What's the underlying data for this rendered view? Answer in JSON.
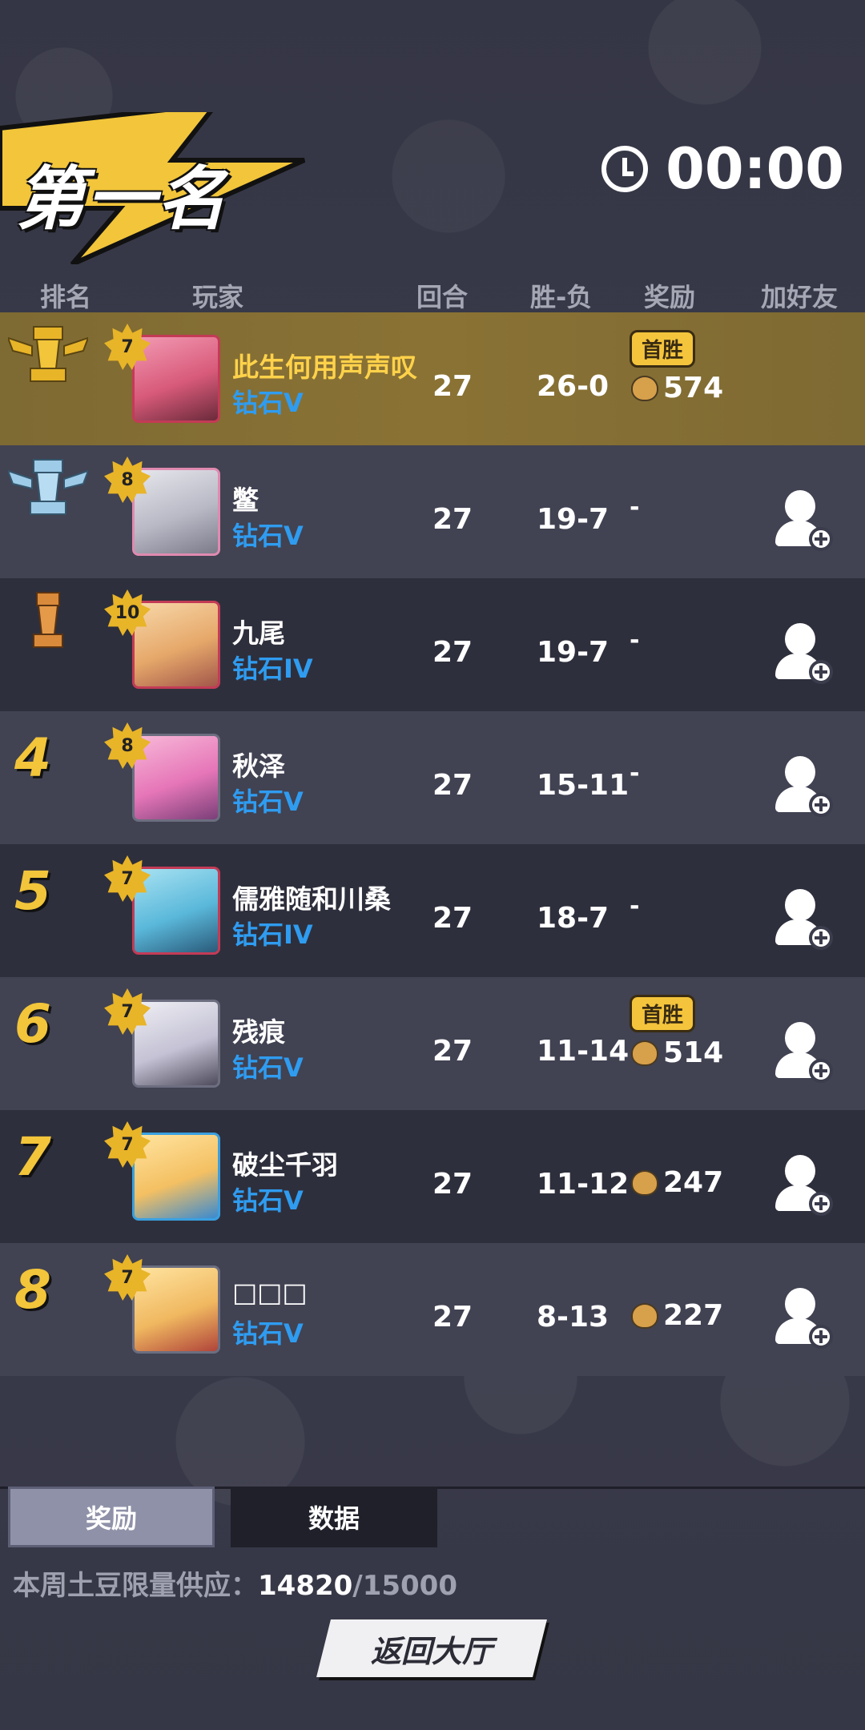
{
  "header": {
    "title": "第一名",
    "timer": "00:00"
  },
  "columns": {
    "rank": "排名",
    "player": "玩家",
    "rounds": "回合",
    "record": "胜-负",
    "reward": "奖励",
    "add_friend": "加好友"
  },
  "players": [
    {
      "rank": "1",
      "level": "7",
      "name": "此生何用声声叹",
      "tier": "钻石V",
      "rounds": "27",
      "record": "26-0",
      "badge": "首胜",
      "reward": "574"
    },
    {
      "rank": "2",
      "level": "8",
      "name": "鳖",
      "tier": "钻石V",
      "rounds": "27",
      "record": "19-7",
      "reward": "-"
    },
    {
      "rank": "3",
      "level": "10",
      "name": "九尾",
      "tier": "钻石IV",
      "rounds": "27",
      "record": "19-7",
      "reward": "-"
    },
    {
      "rank": "4",
      "level": "8",
      "name": "秋泽",
      "tier": "钻石V",
      "rounds": "27",
      "record": "15-11",
      "reward": "-"
    },
    {
      "rank": "5",
      "level": "7",
      "name": "儒雅随和川桑",
      "tier": "钻石IV",
      "rounds": "27",
      "record": "18-7",
      "reward": "-"
    },
    {
      "rank": "6",
      "level": "7",
      "name": "残痕",
      "tier": "钻石V",
      "rounds": "27",
      "record": "11-14",
      "badge": "首胜",
      "reward": "514"
    },
    {
      "rank": "7",
      "level": "7",
      "name": "破尘千羽",
      "tier": "钻石V",
      "rounds": "27",
      "record": "11-12",
      "reward": "247"
    },
    {
      "rank": "8",
      "level": "7",
      "name": "□□□",
      "tier": "钻石V",
      "rounds": "27",
      "record": "8-13",
      "reward": "227"
    }
  ],
  "tabs": {
    "reward": "奖励",
    "data": "数据"
  },
  "supply": {
    "label": "本周土豆限量供应：",
    "current": "14820",
    "total": "/15000"
  },
  "back_button": "返回大厅",
  "colors": {
    "gold": "#f2c53a",
    "tier_blue": "#2f9cf0",
    "first_row": "#8a7234"
  }
}
